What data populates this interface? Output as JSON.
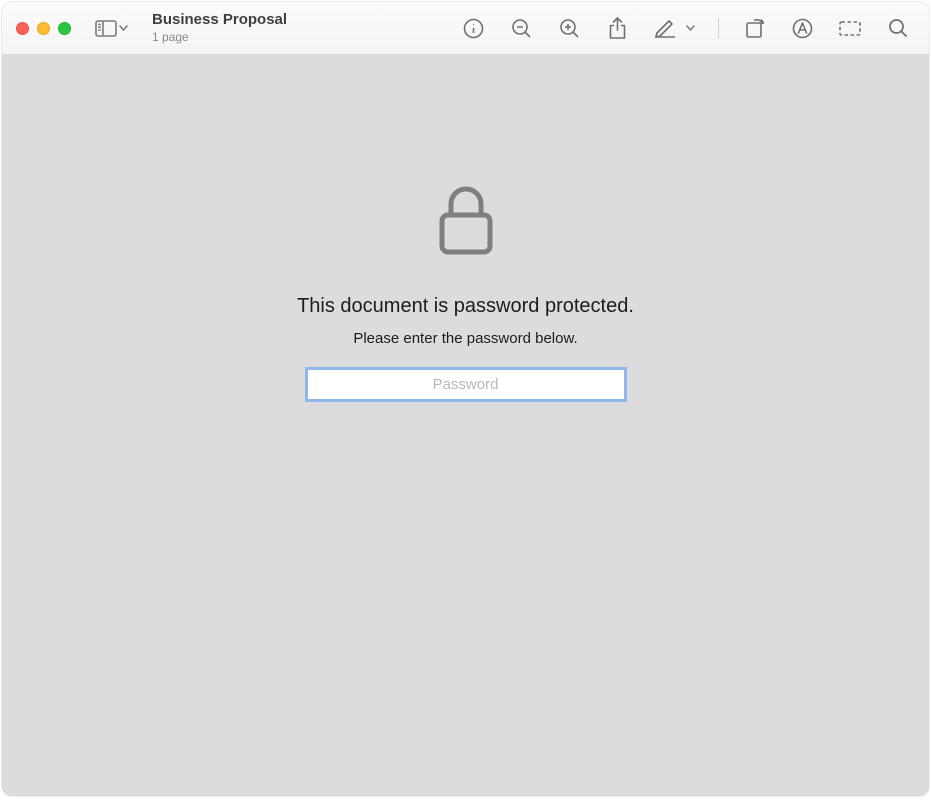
{
  "header": {
    "title": "Business Proposal",
    "subtitle": "1 page"
  },
  "main": {
    "heading": "This document is password protected.",
    "subheading": "Please enter the password below.",
    "password_placeholder": "Password"
  }
}
